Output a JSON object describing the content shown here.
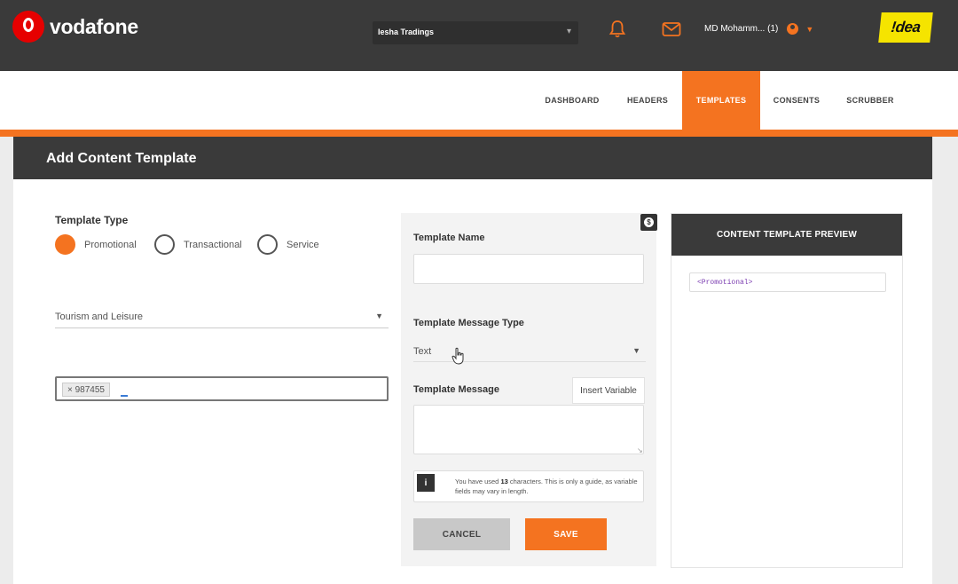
{
  "header": {
    "brand": "vodafone",
    "company_select": "Iesha Tradings",
    "user": "MD Mohamm... (1)",
    "partner_logo": "!dea"
  },
  "nav": {
    "items": [
      "DASHBOARD",
      "HEADERS",
      "TEMPLATES",
      "CONSENTS",
      "SCRUBBER"
    ],
    "active": "TEMPLATES"
  },
  "page": {
    "title": "Add Content Template"
  },
  "form": {
    "template_type_label": "Template Type",
    "types": [
      "Promotional",
      "Transactional",
      "Service"
    ],
    "selected_type": "Promotional",
    "category": "Tourism and Leisure",
    "tag": "× 987455",
    "template_name_label": "Template Name",
    "template_name_value": "",
    "message_type_label": "Template Message Type",
    "message_type_value": "Text",
    "message_label": "Template Message",
    "insert_variable": "Insert Variable",
    "message_value": "",
    "info_prefix": "You have used ",
    "info_count": "13",
    "info_suffix": " characters. This is only a guide, as variable fields may vary in length.",
    "cancel": "CANCEL",
    "save": "SAVE"
  },
  "preview": {
    "title": "CONTENT TEMPLATE PREVIEW",
    "content": "<Promotional>"
  },
  "colors": {
    "accent": "#f47320",
    "dark": "#3a3a3a",
    "vodafone_red": "#e60000",
    "idea_yellow": "#f5e400"
  }
}
